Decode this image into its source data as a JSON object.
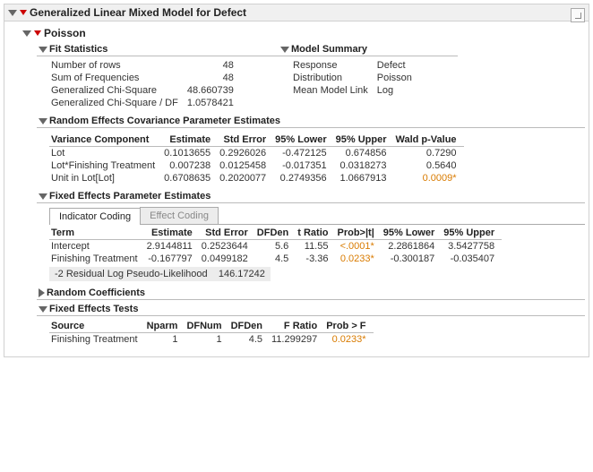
{
  "main_title": "Generalized Linear Mixed Model for Defect",
  "distribution_section": "Poisson",
  "fit_stats": {
    "title": "Fit Statistics",
    "rows": [
      {
        "label": "Number of rows",
        "value": "48"
      },
      {
        "label": "Sum of Frequencies",
        "value": "48"
      },
      {
        "label": "Generalized Chi-Square",
        "value": "48.660739"
      },
      {
        "label": "Generalized Chi-Square / DF",
        "value": "1.0578421"
      }
    ]
  },
  "model_summary": {
    "title": "Model Summary",
    "rows": [
      {
        "label": "Response",
        "value": "Defect"
      },
      {
        "label": "Distribution",
        "value": "Poisson"
      },
      {
        "label": "Mean Model Link",
        "value": "Log"
      }
    ]
  },
  "random_cov": {
    "title": "Random Effects Covariance Parameter Estimates",
    "headers": [
      "Variance Component",
      "Estimate",
      "Std Error",
      "95% Lower",
      "95% Upper",
      "Wald p-Value"
    ],
    "rows": [
      {
        "c0": "Lot",
        "c1": "0.1013655",
        "c2": "0.2926026",
        "c3": "-0.472125",
        "c4": "0.674856",
        "c5": "0.7290",
        "sig": false
      },
      {
        "c0": "Lot*Finishing Treatment",
        "c1": "0.007238",
        "c2": "0.0125458",
        "c3": "-0.017351",
        "c4": "0.0318273",
        "c5": "0.5640",
        "sig": false
      },
      {
        "c0": "Unit in Lot[Lot]",
        "c1": "0.6708635",
        "c2": "0.2020077",
        "c3": "0.2749356",
        "c4": "1.0667913",
        "c5": "0.0009*",
        "sig": true
      }
    ]
  },
  "fixed_params": {
    "title": "Fixed Effects Parameter Estimates",
    "tabs": {
      "active": "Indicator Coding",
      "inactive": "Effect Coding"
    },
    "headers": [
      "Term",
      "Estimate",
      "Std Error",
      "DFDen",
      "t Ratio",
      "Prob>|t|",
      "95% Lower",
      "95% Upper"
    ],
    "rows": [
      {
        "c0": "Intercept",
        "c1": "2.9144811",
        "c2": "0.2523644",
        "c3": "5.6",
        "c4": "11.55",
        "c5": "<.0001*",
        "c6": "2.2861864",
        "c7": "3.5427758",
        "sig": true
      },
      {
        "c0": "Finishing Treatment",
        "c1": "-0.167797",
        "c2": "0.0499182",
        "c3": "4.5",
        "c4": "-3.36",
        "c5": "0.0233*",
        "c6": "-0.300187",
        "c7": "-0.035407",
        "sig": true
      }
    ],
    "footer_label": "-2 Residual Log Pseudo-Likelihood",
    "footer_value": "146.17242"
  },
  "random_coef": {
    "title": "Random Coefficients"
  },
  "fixed_tests": {
    "title": "Fixed Effects Tests",
    "headers": [
      "Source",
      "Nparm",
      "DFNum",
      "DFDen",
      "F Ratio",
      "Prob > F"
    ],
    "rows": [
      {
        "c0": "Finishing Treatment",
        "c1": "1",
        "c2": "1",
        "c3": "4.5",
        "c4": "11.299297",
        "c5": "0.0233*",
        "sig": true
      }
    ]
  }
}
